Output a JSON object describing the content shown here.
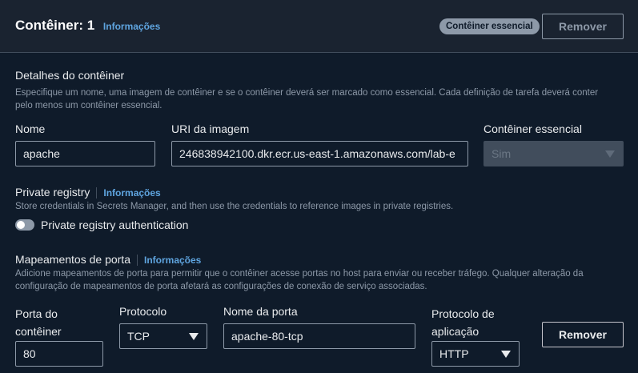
{
  "header": {
    "title": "Contêiner: 1",
    "info_label": "Informações",
    "essential_badge": "Contêiner essencial",
    "remove_label": "Remover"
  },
  "details": {
    "title": "Detalhes do contêiner",
    "description": "Especifique um nome, uma imagem de contêiner e se o contêiner deverá ser marcado como essencial. Cada definição de tarefa deverá conter pelo menos um contêiner essencial.",
    "name_label": "Nome",
    "name_value": "apache",
    "uri_label": "URI da imagem",
    "uri_value": "246838942100.dkr.ecr.us-east-1.amazonaws.com/lab-e",
    "essential_label": "Contêiner essencial",
    "essential_value": "Sim"
  },
  "registry": {
    "title": "Private registry",
    "info_label": "Informações",
    "description": "Store credentials in Secrets Manager, and then use the credentials to reference images in private registries.",
    "toggle_label": "Private registry authentication",
    "toggle_on": false
  },
  "ports": {
    "title": "Mapeamentos de porta",
    "info_label": "Informações",
    "description": "Adicione mapeamentos de porta para permitir que o contêiner acesse portas no host para enviar ou receber tráfego. Qualquer alteração da configuração de mapeamentos de porta afetará as configurações de conexão de serviço associadas.",
    "container_port_label_1": "Porta do",
    "container_port_label_2": "contêiner",
    "container_port_value": "80",
    "protocol_label": "Protocolo",
    "protocol_value": "TCP",
    "port_name_label": "Nome da porta",
    "port_name_value": "apache-80-tcp",
    "app_protocol_label_1": "Protocolo de",
    "app_protocol_label_2": "aplicação",
    "app_protocol_value": "HTTP",
    "remove_label": "Remover"
  },
  "colors": {
    "background": "#0f1b2a",
    "header_bg": "#1a2330",
    "link": "#5fa5e0",
    "border": "#8d99a8"
  }
}
